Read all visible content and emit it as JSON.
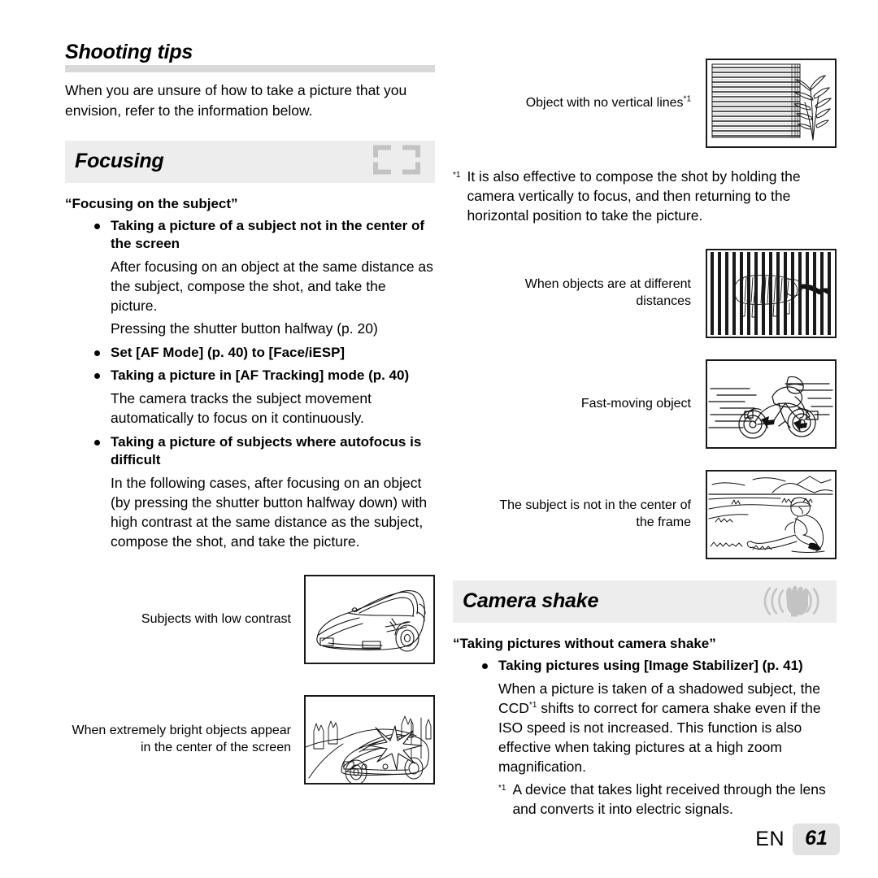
{
  "document": {
    "title": "Shooting tips",
    "intro": "When you are unsure of how to take a picture that you envision, refer to the information below."
  },
  "sections": {
    "focusing": {
      "title": "Focusing",
      "icon": "focus-frame-icon",
      "subhead": "“Focusing on the subject”",
      "bullets": [
        {
          "label": "Taking a picture of a subject not in the center of the screen",
          "paragraphs": [
            "After focusing on an object at the same distance as the subject, compose the shot, and take the picture.",
            "Pressing the shutter button halfway (p. 20)"
          ]
        },
        {
          "label": "Set [AF Mode] (p. 40) to [Face/iESP]",
          "paragraphs": []
        },
        {
          "label": "Taking a picture in [AF Tracking] mode (p. 40)",
          "paragraphs": [
            "The camera tracks the subject movement automatically to focus on it continuously."
          ]
        },
        {
          "label": "Taking a picture of subjects where autofocus is difficult",
          "paragraphs": [
            "In the following cases, after focusing on an object (by pressing the shutter button halfway down) with high contrast at the same distance as the subject, compose the shot, and take the picture."
          ]
        }
      ]
    },
    "camera_shake": {
      "title": "Camera shake",
      "icon": "hand-shake-icon",
      "subhead": "“Taking pictures without camera shake”",
      "bullets": [
        {
          "label": "Taking pictures using [Image Stabilizer] (p. 41)",
          "paragraphs": [
            "When a picture is taken of a shadowed subject, the CCD*1 shifts to correct for camera shake even if the ISO speed is not increased. This function is also effective when taking pictures at a high zoom magnification."
          ]
        }
      ],
      "footnote": {
        "mark": "*1",
        "text": "A device that takes light received through the lens and converts it into electric signals."
      }
    }
  },
  "figures": {
    "low_contrast": {
      "caption": "Subjects with low contrast",
      "illustration": "sports-car-illustration"
    },
    "bright_objects": {
      "caption": "When extremely bright objects appear in the center of the screen",
      "illustration": "car-with-sun-flare-illustration"
    },
    "no_vertical_lines": {
      "caption": "Object with no vertical lines",
      "caption_sup": "*1",
      "illustration": "horizontal-blinds-with-plant-illustration"
    },
    "different_distances": {
      "caption": "When objects are at different distances",
      "illustration": "tiger-behind-bars-illustration"
    },
    "fast_moving": {
      "caption": "Fast-moving object",
      "illustration": "motorcycle-speed-illustration"
    },
    "off_center": {
      "caption": "The subject is not in the center of the frame",
      "illustration": "person-on-beach-illustration"
    }
  },
  "footnotes": {
    "vertical_lines": {
      "mark": "*1",
      "text": "It is also effective to compose the shot by holding the camera vertically to focus, and then returning to the horizontal position to take the picture."
    }
  },
  "footer": {
    "language": "EN",
    "page_number": "61"
  },
  "colors": {
    "section_bar": "#ededed",
    "rule": "#d9d9d9",
    "icon_gray": "#c3c3c3",
    "page_badge": "#e2e2e2",
    "text": "#000000"
  }
}
